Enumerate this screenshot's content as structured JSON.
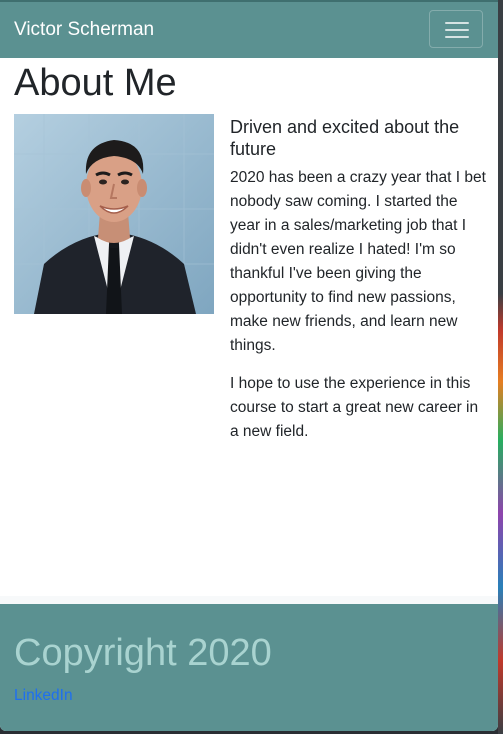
{
  "navbar": {
    "brand": "Victor Scherman",
    "toggler_icon": "hamburger-menu-icon"
  },
  "main": {
    "title": "About Me",
    "photo": {
      "description_icon": "portrait-photo"
    },
    "subtitle": "Driven and excited about the future",
    "paragraphs": [
      "2020 has been a crazy year that I bet nobody saw coming. I started the year in a sales/marketing job that I didn't even realize I hated! I'm so thankful I've been giving the opportunity to find new passions, make new friends, and learn new things.",
      "I hope to use the experience in this course to start a great new career in a new field."
    ]
  },
  "footer": {
    "copyright": "Copyright 2020",
    "link_label": "LinkedIn"
  },
  "colors": {
    "accent": "#5b9191",
    "footer_text": "#a9d3d0",
    "link": "#1e6ff0"
  }
}
